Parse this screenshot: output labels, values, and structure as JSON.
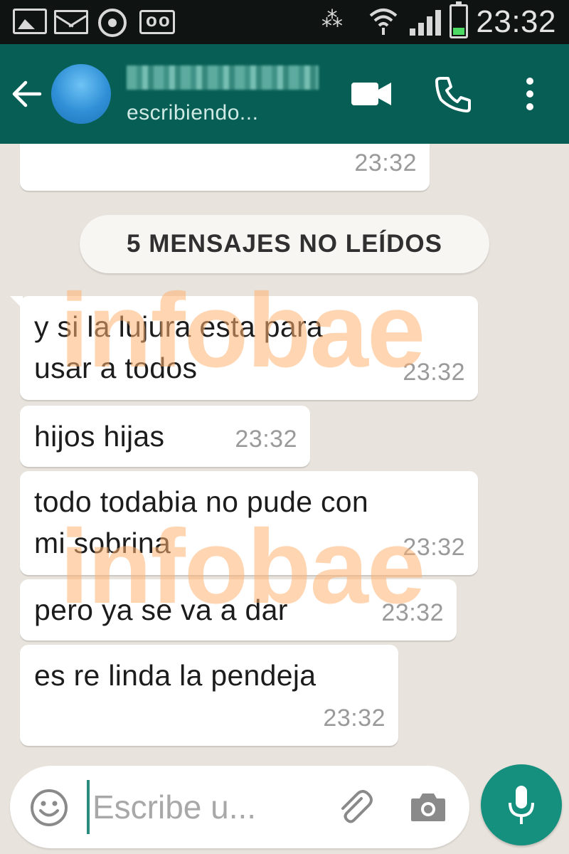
{
  "status_bar": {
    "time": "23:32",
    "icons": [
      "gallery-icon",
      "mail-icon",
      "media-icon",
      "voicemail-icon",
      "nfc-icon",
      "wifi-icon",
      "signal-icon",
      "battery-icon"
    ]
  },
  "header": {
    "contact_status": "escribiendo...",
    "icons": [
      "back-arrow-icon",
      "avatar",
      "video-call-icon",
      "phone-icon",
      "more-vert-icon"
    ],
    "accent_color": "#075e54"
  },
  "chat": {
    "previous_message_time": "23:32",
    "unread_banner": "5 MENSAJES NO LEÍDOS",
    "messages": [
      {
        "text": "y si la lujura esta para\nusar a todos",
        "time": "23:32"
      },
      {
        "text": "hijos hijas",
        "time": "23:32"
      },
      {
        "text": "todo todabia no pude con\nmi sobrina",
        "time": "23:32"
      },
      {
        "text": "pero ya se va a dar",
        "time": "23:32"
      },
      {
        "text": "es re linda la pendeja",
        "time": "23:32"
      }
    ],
    "watermark": [
      "infobae",
      "infobae"
    ]
  },
  "input_bar": {
    "placeholder": "Escribe u...",
    "icons": [
      "emoji-icon",
      "attach-icon",
      "camera-icon",
      "mic-icon"
    ],
    "mic_button_color": "#15907f"
  }
}
